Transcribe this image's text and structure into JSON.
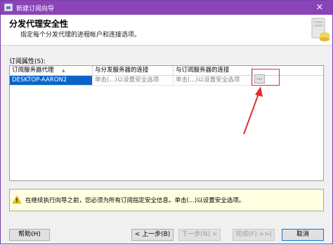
{
  "window": {
    "title": "新建订阅向导",
    "close_glyph": "×"
  },
  "header": {
    "title": "分发代理安全性",
    "subtitle": "指定每个分发代理的进程帐户和连接选项。"
  },
  "section_label": "订阅属性(S):",
  "grid": {
    "columns": [
      "订阅服务器代理",
      "与分发服务器的连接",
      "与订阅服务器的连接"
    ],
    "sort_glyph": "▲",
    "rows": [
      {
        "agent": "DESKTOP-AARON2",
        "distributor_conn": "单击(...)以设置安全选项",
        "subscriber_conn": "单击(...)以设置安全选项"
      }
    ],
    "ellipsis_label": "..."
  },
  "warning": {
    "icon": "warning-icon",
    "text": "在继续执行向导之前，您必须为所有订阅指定安全信息。单击(...)以设置安全选项。"
  },
  "buttons": {
    "help": "帮助(H)",
    "back": "< 上一步(B)",
    "next": "下一步(N) >",
    "finish": "完成(F) >>|",
    "cancel": "取消"
  },
  "colors": {
    "titlebar": "#8a44b8",
    "selection": "#0a64c8",
    "annotation": "#e03030",
    "warning_bg": "#ffffe1"
  }
}
